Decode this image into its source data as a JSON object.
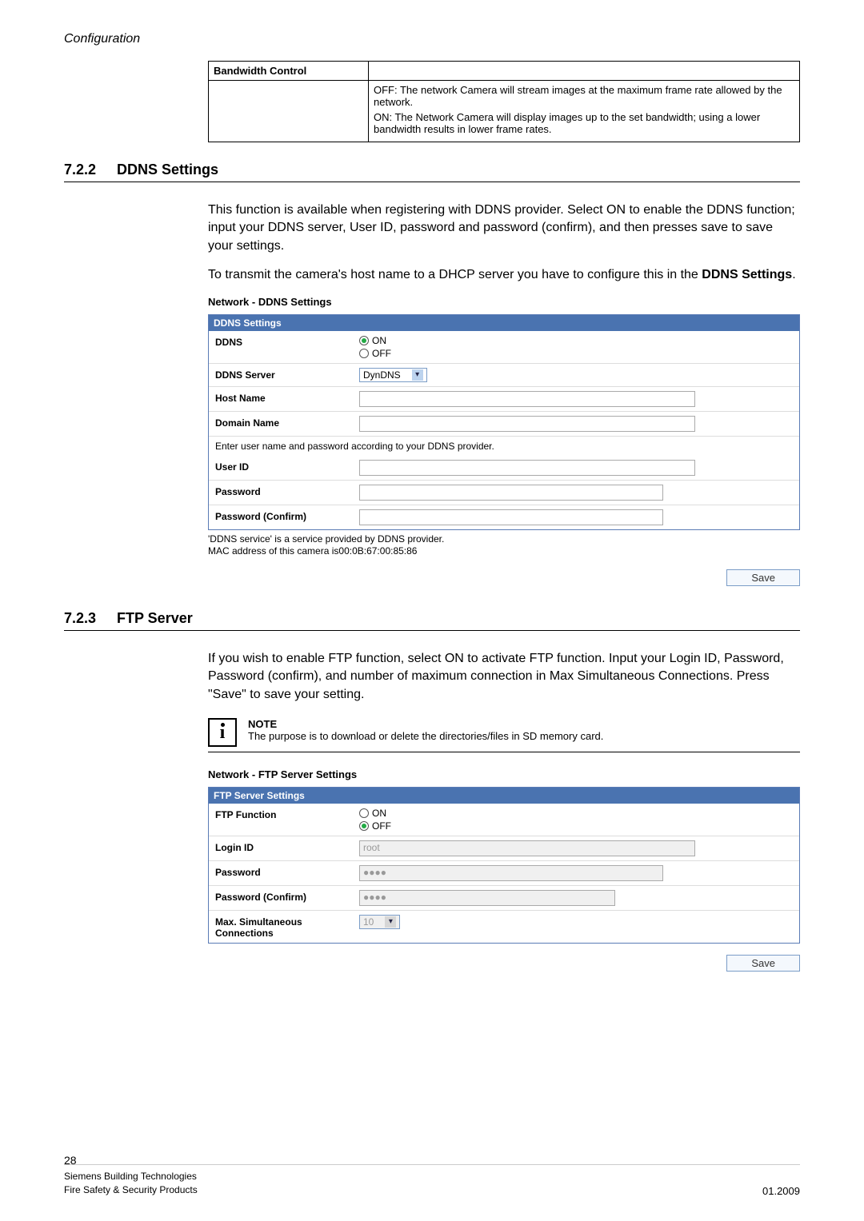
{
  "header": {
    "title": "Configuration"
  },
  "bandwidth": {
    "heading": "Bandwidth Control",
    "off_text": "OFF: The network Camera will stream images at the maximum frame rate allowed by the network.",
    "on_text": "ON: The Network Camera will display images up to the set bandwidth; using a lower bandwidth results in lower frame rates."
  },
  "sec1": {
    "num": "7.2.2",
    "title": "DDNS Settings",
    "p1": "This function is available when registering with DDNS provider. Select ON to enable the DDNS function; input your DDNS server, User ID, password and password (confirm), and then presses save to save your settings.",
    "p2a": "To transmit the camera's host name to a DHCP server you have to configure this in the ",
    "p2b": "DDNS Settings",
    "p2c": "."
  },
  "ddns_panel": {
    "title": "Network - DDNS Settings",
    "head": "DDNS Settings",
    "rows": {
      "ddns_label": "DDNS",
      "on": "ON",
      "off": "OFF",
      "server_label": "DDNS Server",
      "server_value": "DynDNS",
      "host_label": "Host Name",
      "domain_label": "Domain Name",
      "note": "Enter user name and password according to your DDNS provider.",
      "user_label": "User ID",
      "pw_label": "Password",
      "pwc_label": "Password (Confirm)"
    },
    "foot1": "'DDNS service' is a service provided by DDNS provider.",
    "foot2": "MAC address of this camera is00:0B:67:00:85:86",
    "save": "Save"
  },
  "sec2": {
    "num": "7.2.3",
    "title": "FTP Server",
    "p1": "If you wish to enable FTP function, select ON to activate FTP function. Input your Login ID, Password, Password (confirm), and number of maximum connection in Max Simultaneous Connections. Press \"Save\" to save your setting."
  },
  "note": {
    "head": "NOTE",
    "body": "The purpose is to download or delete the directories/files in SD memory card."
  },
  "ftp_panel": {
    "title": "Network - FTP Server Settings",
    "head": "FTP Server Settings",
    "rows": {
      "func_label": "FTP Function",
      "on": "ON",
      "off": "OFF",
      "login_label": "Login ID",
      "login_value": "root",
      "pw_label": "Password",
      "pw_value": "●●●●",
      "pwc_label": "Password (Confirm)",
      "pwc_value": "●●●●",
      "max_label": "Max. Simultaneous Connections",
      "max_value": "10"
    },
    "save": "Save"
  },
  "footer": {
    "page": "28",
    "line1": "Siemens Building Technologies",
    "line2": "Fire Safety & Security Products",
    "date": "01.2009"
  }
}
